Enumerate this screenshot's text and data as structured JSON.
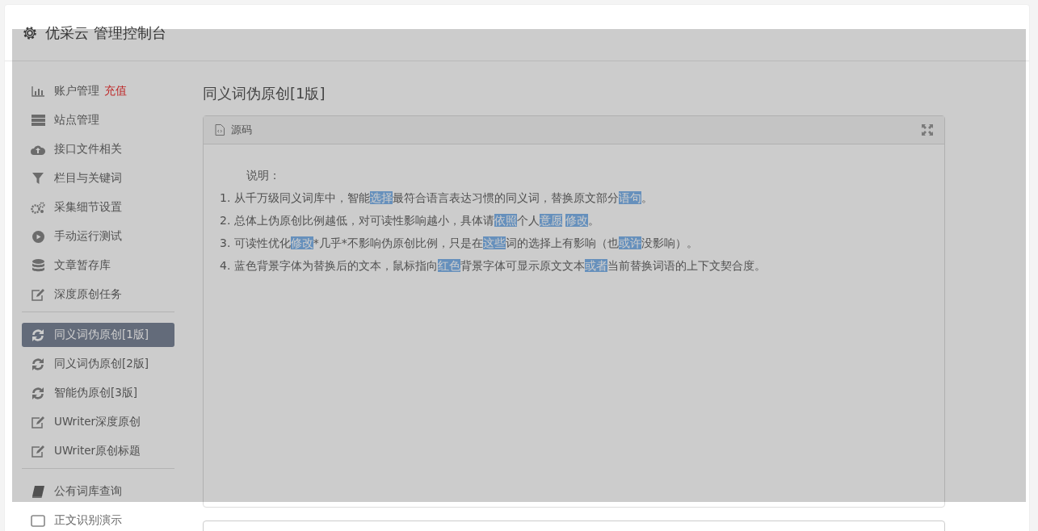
{
  "header": {
    "title": "优采云 管理控制台"
  },
  "sidebar": {
    "groups": [
      {
        "items": [
          {
            "label": "账户管理",
            "badge": "充值",
            "kind": "chart",
            "selected": false
          },
          {
            "label": "站点管理",
            "kind": "server",
            "selected": false
          },
          {
            "label": "接口文件相关",
            "kind": "cloud",
            "selected": false
          },
          {
            "label": "栏目与关键词",
            "kind": "filter",
            "selected": false
          },
          {
            "label": "采集细节设置",
            "kind": "gears",
            "selected": false
          },
          {
            "label": "手动运行测试",
            "kind": "play",
            "selected": false
          },
          {
            "label": "文章暂存库",
            "kind": "database",
            "selected": false
          },
          {
            "label": "深度原创任务",
            "kind": "edit",
            "selected": false
          }
        ]
      },
      {
        "items": [
          {
            "label": "同义词伪原创[1版]",
            "kind": "refresh",
            "selected": true
          },
          {
            "label": "同义词伪原创[2版]",
            "kind": "refresh",
            "selected": false
          },
          {
            "label": "智能伪原创[3版]",
            "kind": "refresh",
            "selected": false
          },
          {
            "label": "UWriter深度原创",
            "kind": "edit",
            "selected": false
          },
          {
            "label": "UWriter原创标题",
            "kind": "edit",
            "selected": false
          }
        ]
      },
      {
        "items": [
          {
            "label": "公有词库查询",
            "kind": "book",
            "selected": false
          },
          {
            "label": "正文识别演示",
            "kind": "square",
            "selected": false
          }
        ]
      }
    ]
  },
  "content": {
    "title": "同义词伪原创[1版]",
    "panel": {
      "title": "源码",
      "intro": "说明：",
      "lines": [
        [
          {
            "text": "1. 从千万级同义词库中，智能",
            "highlighted": false
          },
          {
            "text": "选择",
            "highlighted": true
          },
          {
            "text": "最符合语言表达习惯的同义词，替换原文部分",
            "highlighted": false
          },
          {
            "text": "语句",
            "highlighted": true
          },
          {
            "text": "。",
            "highlighted": false
          }
        ],
        [
          {
            "text": "2. 总体上伪原创比例越低，对可读性影响越小，具体请",
            "highlighted": false
          },
          {
            "text": "依照",
            "highlighted": true
          },
          {
            "text": "个人",
            "highlighted": false
          },
          {
            "text": "意愿",
            "highlighted": true
          },
          {
            "text": "修改",
            "highlighted": true
          },
          {
            "text": "。",
            "highlighted": false
          }
        ],
        [
          {
            "text": "3. 可读性优化",
            "highlighted": false
          },
          {
            "text": "修改",
            "highlighted": true
          },
          {
            "text": "*几乎*不影响伪原创比例，只是在",
            "highlighted": false
          },
          {
            "text": "这些",
            "highlighted": true
          },
          {
            "text": "词的选择上有影响（也",
            "highlighted": false
          },
          {
            "text": "或许",
            "highlighted": true
          },
          {
            "text": "没影响）。",
            "highlighted": false
          }
        ],
        [
          {
            "text": "4. 蓝色背景字体为替换后的文本，鼠标指向",
            "highlighted": false
          },
          {
            "text": "红色",
            "highlighted": true
          },
          {
            "text": "背景字体可显示原文文本",
            "highlighted": false
          },
          {
            "text": "或者",
            "highlighted": true
          },
          {
            "text": "当前替换词语的上下文契合度。",
            "highlighted": false
          }
        ]
      ]
    }
  },
  "mask": {
    "visible": true
  }
}
